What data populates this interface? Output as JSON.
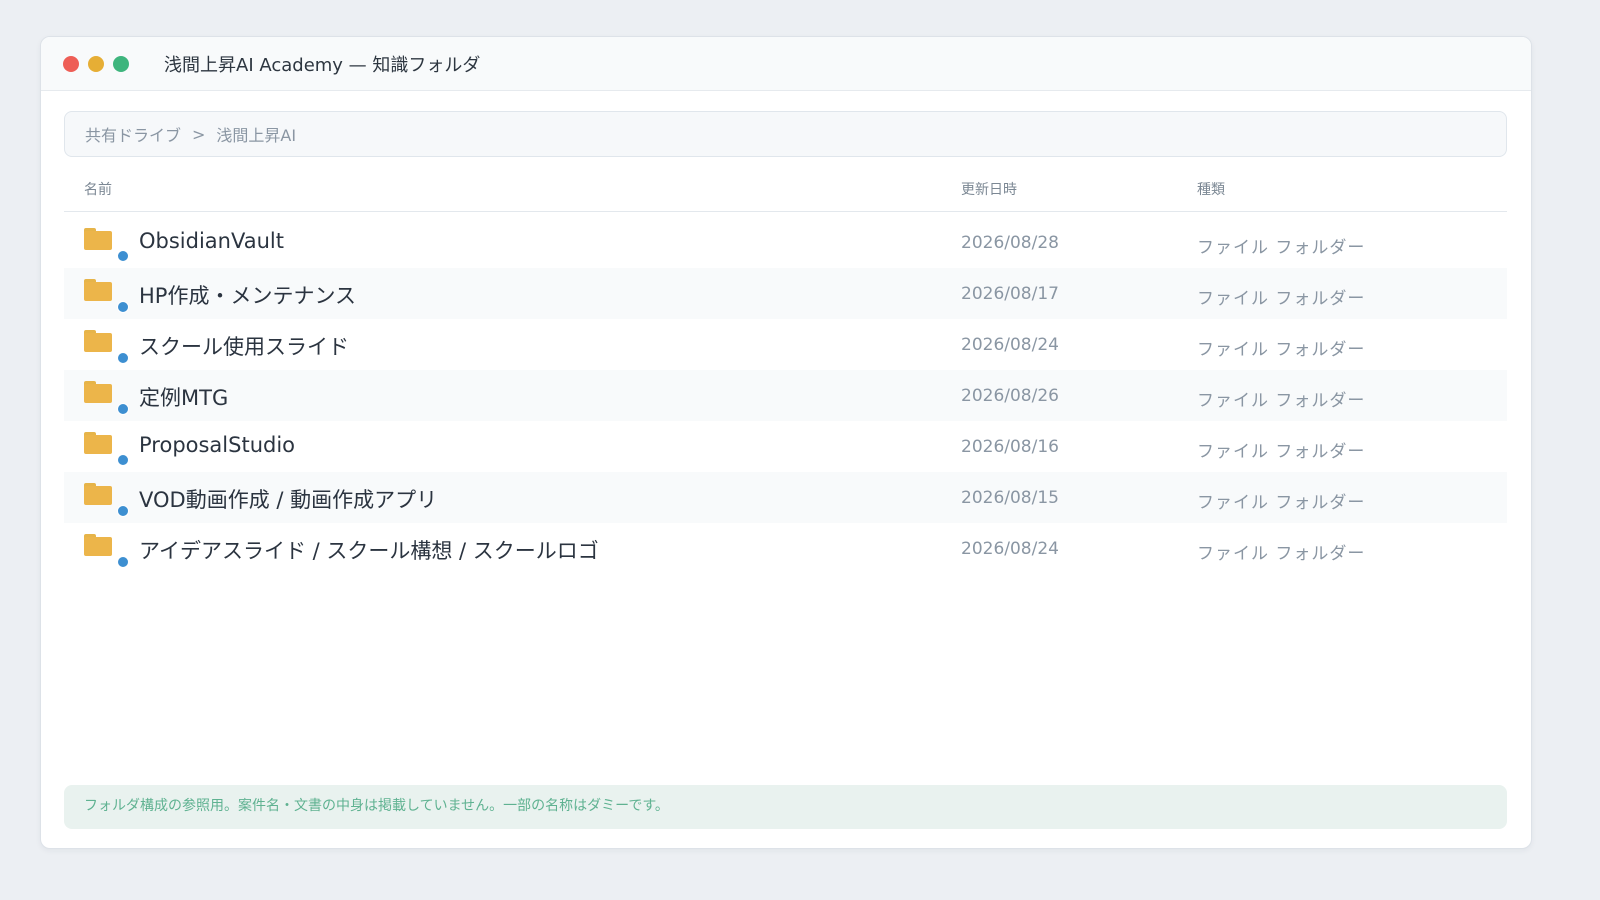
{
  "window": {
    "title": "浅間上昇AI Academy — 知識フォルダ"
  },
  "breadcrumb": {
    "items": [
      "共有ドライブ",
      "浅間上昇AI"
    ],
    "separator": ">"
  },
  "columns": {
    "name": "名前",
    "modified": "更新日時",
    "kind": "種類"
  },
  "files": [
    {
      "name": "ObsidianVault",
      "modified": "2026/08/28",
      "kind": "ファイル フォルダー",
      "icon": "folder-icon"
    },
    {
      "name": "HP作成・メンテナンス",
      "modified": "2026/08/17",
      "kind": "ファイル フォルダー",
      "icon": "folder-icon"
    },
    {
      "name": "スクール使用スライド",
      "modified": "2026/08/24",
      "kind": "ファイル フォルダー",
      "icon": "folder-icon"
    },
    {
      "name": "定例MTG",
      "modified": "2026/08/26",
      "kind": "ファイル フォルダー",
      "icon": "folder-icon"
    },
    {
      "name": "ProposalStudio",
      "modified": "2026/08/16",
      "kind": "ファイル フォルダー",
      "icon": "folder-icon"
    },
    {
      "name": "VOD動画作成 / 動画作成アプリ",
      "modified": "2026/08/15",
      "kind": "ファイル フォルダー",
      "icon": "folder-icon"
    },
    {
      "name": "アイデアスライド / スクール構想 / スクールロゴ",
      "modified": "2026/08/24",
      "kind": "ファイル フォルダー",
      "icon": "folder-icon"
    }
  ],
  "footer": {
    "notice": "フォルダ構成の参照用。案件名・文書の中身は掲載していません。一部の名称はダミーです。"
  },
  "colors": {
    "folder": "#ecb54a",
    "sync_badge": "#3d8fd1",
    "notice_text": "#5fb291"
  }
}
